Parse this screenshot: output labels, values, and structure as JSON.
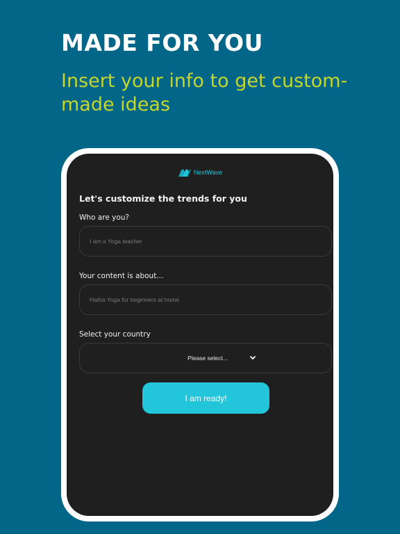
{
  "promo": {
    "headline": "MADE FOR YOU",
    "subheadline": "Insert your info to get custom-made ideas"
  },
  "app": {
    "brand_name": "NextWave",
    "logo_icon": "nextwave-logo-icon",
    "form_title": "Let's customize the trends for you",
    "fields": [
      {
        "label": "Who are you?",
        "value": "",
        "placeholder": "I am a Yoga teacher"
      },
      {
        "label": "Your content is about...",
        "value": "",
        "placeholder": "Hatha Yoga for beginners at home"
      }
    ],
    "country": {
      "label": "Select your country",
      "selected": "Please select...",
      "icon": "chevron-down-icon"
    },
    "submit_label": "I am ready!"
  },
  "colors": {
    "background": "#026689",
    "headline": "#ffffff",
    "subheadline": "#c6d62c",
    "screen": "#1f1f1f",
    "accent": "#22c5d9",
    "field_border": "#3a3a3a"
  }
}
